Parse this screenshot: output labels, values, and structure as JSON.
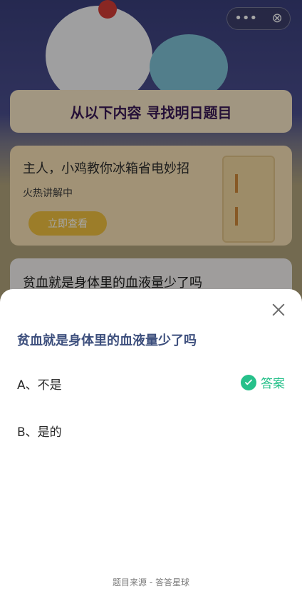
{
  "top_controls": {
    "more": "•••",
    "close": "⊗"
  },
  "header": {
    "title": "从以下内容 寻找明日题目"
  },
  "feature_card": {
    "title": "主人，小鸡教你冰箱省电妙招",
    "subtitle": "火热讲解中",
    "button": "立即查看"
  },
  "question_peek": {
    "text": "贫血就是身体里的血液量少了吗"
  },
  "modal": {
    "question": "贫血就是身体里的血液量少了吗",
    "options": [
      {
        "label": "A、不是"
      },
      {
        "label": "B、是的"
      }
    ],
    "answer_label": "答案",
    "source": "题目来源 - 答答星球"
  },
  "colors": {
    "accent_green": "#26c08a",
    "question_text": "#3d4f7d",
    "button_yellow": "#f0c040"
  }
}
